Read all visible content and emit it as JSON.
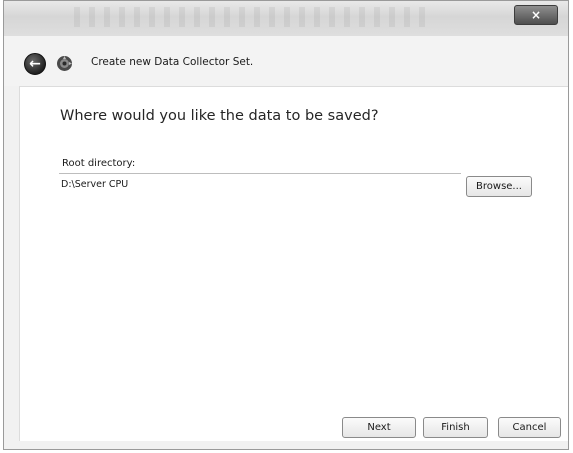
{
  "window": {
    "close_label": "×",
    "colors": {
      "titlebar": "#d9d9d9",
      "close": "#5a5a5a"
    }
  },
  "header": {
    "back_icon": "arrow-left-icon",
    "app_icon": "data-collector-icon",
    "title": "Create new Data Collector Set."
  },
  "main": {
    "question": "Where would you like the data to be saved?",
    "root_directory_label": "Root directory:",
    "root_directory_value": "D:\\Server CPU",
    "browse_label": "Browse..."
  },
  "footer": {
    "next_label": "Next",
    "finish_label": "Finish",
    "cancel_label": "Cancel"
  }
}
